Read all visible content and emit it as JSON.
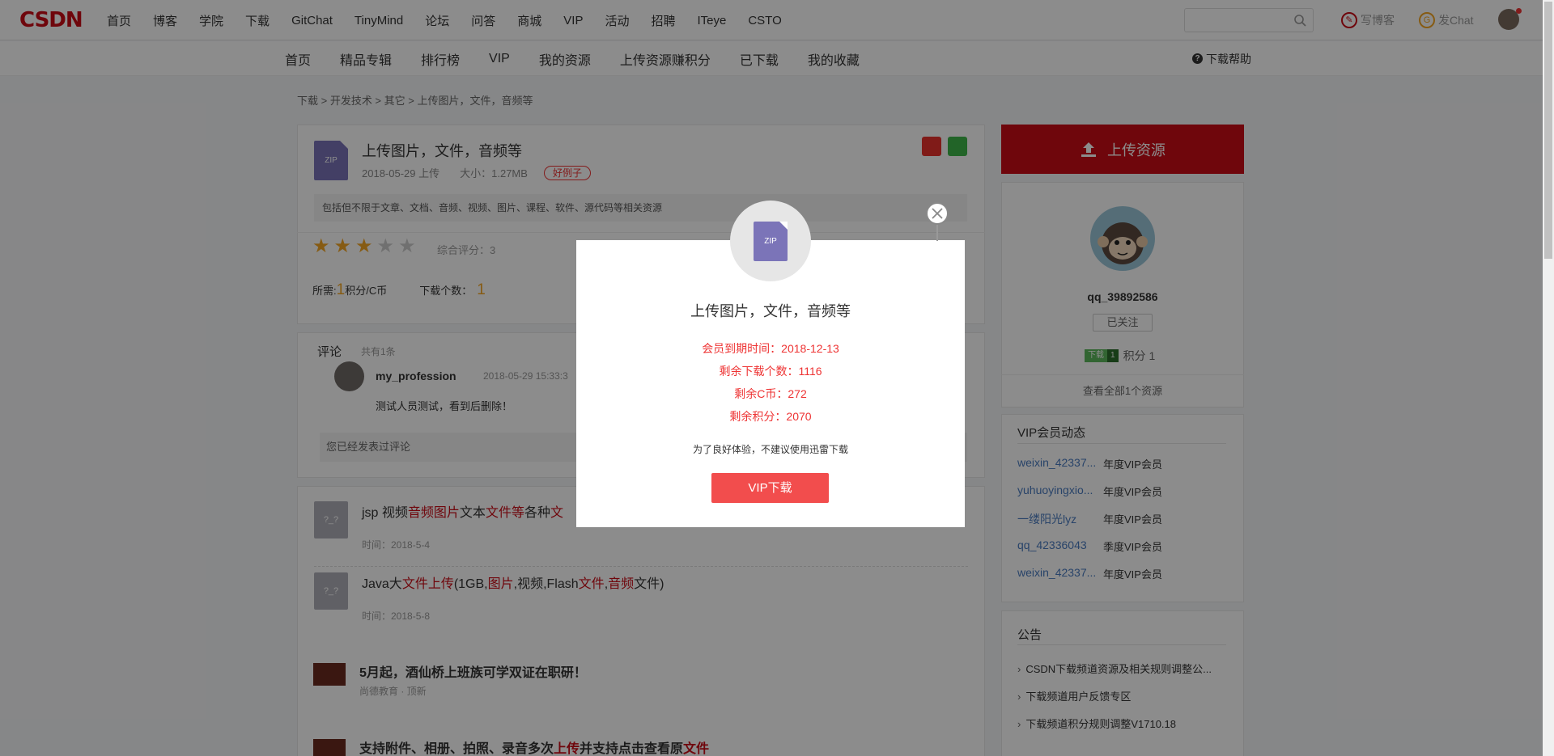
{
  "topbar": {
    "logo": "CSDN",
    "nav": [
      "首页",
      "博客",
      "学院",
      "下载",
      "GitChat",
      "TinyMind",
      "论坛",
      "问答",
      "商城",
      "VIP",
      "活动",
      "招聘",
      "ITeye",
      "CSTO"
    ],
    "write_blog": "写博客",
    "write_chat": "发Chat",
    "search_placeholder": ""
  },
  "subnav": {
    "items": [
      "首页",
      "精品专辑",
      "排行榜",
      "VIP",
      "我的资源",
      "上传资源赚积分",
      "已下载",
      "我的收藏"
    ],
    "help": "下载帮助"
  },
  "breadcrumb": "下载 >  开发技术 >  其它 >  上传图片，文件，音频等",
  "resource": {
    "icon_label": "ZIP",
    "title": "上传图片，文件，音频等",
    "date": "2018-05-29 上传",
    "size": "大小：1.27MB",
    "tag": "好例子",
    "description": "包括但不限于文章、文档、音频、视频、图片、课程、软件、源代码等相关资源",
    "rating_value": 3,
    "rating_max": 5,
    "rating_text": "综合评分：3",
    "cost_prefix": "所需:",
    "cost_value": "1",
    "cost_suffix": "积分/C币",
    "downloads_label": "下载个数：",
    "downloads_value": "1"
  },
  "comments": {
    "title": "评论",
    "count": "共有1条",
    "items": [
      {
        "user": "my_profession",
        "time": "2018-05-29 15:33:3",
        "text": "测试人员测试，看到后删除！"
      }
    ],
    "commented_note": "您已经发表过评论"
  },
  "related": [
    {
      "icon": "?_?",
      "title_parts": [
        [
          "jsp 视频",
          false
        ],
        [
          "音频图片",
          true
        ],
        [
          "文本",
          false
        ],
        [
          "文件等",
          true
        ],
        [
          "各种",
          false
        ],
        [
          "文",
          true
        ]
      ],
      "time": "时间：2018-5-4"
    },
    {
      "icon": "?_?",
      "title_parts": [
        [
          "Java大",
          false
        ],
        [
          "文件上传",
          true
        ],
        [
          "(1GB,",
          false
        ],
        [
          "图片",
          true
        ],
        [
          ",视频,Flash",
          false
        ],
        [
          "文件",
          true
        ],
        [
          ",",
          false
        ],
        [
          "音频",
          true
        ],
        [
          "文件)",
          false
        ]
      ],
      "time": "时间：2018-5-8"
    },
    {
      "icon": "",
      "title_parts": [
        [
          "5月起，酒仙桥上班族可学双证在职研！",
          false
        ]
      ],
      "time": "尚德教育 · 顶新"
    },
    {
      "icon": "",
      "title_parts": [
        [
          "支持附件、相册、拍照、录音多次",
          false
        ],
        [
          "上传",
          true
        ],
        [
          "并支持点击查看原",
          false
        ],
        [
          "文件",
          true
        ]
      ],
      "time": ""
    }
  ],
  "sidebar": {
    "upload_button": "上传资源",
    "username": "qq_39892586",
    "follow_label": "已关注",
    "dl_badge": "下载",
    "dl_level": "1",
    "points_label": "积分 1",
    "view_all": "查看全部1个资源",
    "vip_title": "VIP会员动态",
    "vip_rows": [
      {
        "name": "weixin_42337...",
        "type": "年度VIP会员"
      },
      {
        "name": "yuhuoyingxio...",
        "type": "年度VIP会员"
      },
      {
        "name": "一缕阳光lyz",
        "type": "年度VIP会员"
      },
      {
        "name": "qq_42336043",
        "type": "季度VIP会员"
      },
      {
        "name": "weixin_42337...",
        "type": "年度VIP会员"
      }
    ],
    "notice_title": "公告",
    "notices": [
      "CSDN下载频道资源及相关规则调整公...",
      "下载频道用户反馈专区",
      "下载频道积分规则调整V1710.18"
    ]
  },
  "modal": {
    "icon_label": "ZIP",
    "title": "上传图片，文件，音频等",
    "expire": "会员到期时间：2018-12-13",
    "remaining_downloads": "剩余下载个数：1116",
    "remaining_coins": "剩余C币：272",
    "remaining_points": "剩余积分：2070",
    "tip": "为了良好体验，不建议使用迅雷下载",
    "vip_button": "VIP下载"
  },
  "colors": {
    "brand": "#ca0c16",
    "vip_button": "#f24d4d",
    "link": "#4a7bc0",
    "accent_orange": "#f5a623"
  }
}
